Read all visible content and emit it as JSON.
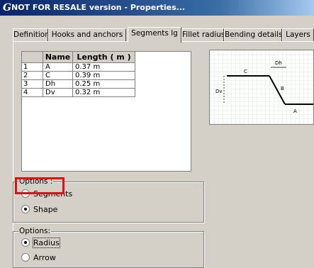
{
  "window": {
    "logo": "G",
    "title": "NOT FOR RESALE version - Properties..."
  },
  "tabs": [
    {
      "label": "Definition"
    },
    {
      "label": "Hooks and anchors"
    },
    {
      "label": "Segments lg"
    },
    {
      "label": "Fillet radius"
    },
    {
      "label": "Bending details"
    },
    {
      "label": "Layers"
    }
  ],
  "table": {
    "headers": {
      "name": "Name",
      "length": "Length ( m )"
    },
    "rows": [
      {
        "num": "1",
        "name": "A",
        "length": "0.37 m"
      },
      {
        "num": "2",
        "name": "C",
        "length": "0.39 m"
      },
      {
        "num": "3",
        "name": "Dh",
        "length": "0.25 m"
      },
      {
        "num": "4",
        "name": "Dv",
        "length": "0.32 m"
      }
    ]
  },
  "diagram": {
    "labels": {
      "c": "C",
      "dh": "Dh",
      "dv": "Dv",
      "b": "B",
      "a": "A"
    }
  },
  "options1": {
    "legend": "Options :",
    "items": [
      {
        "label": "Segments",
        "selected": false
      },
      {
        "label": "Shape",
        "selected": true
      }
    ]
  },
  "options2": {
    "legend": "Options:",
    "items": [
      {
        "label": "Radius",
        "selected": true
      },
      {
        "label": "Arrow",
        "selected": false
      }
    ]
  },
  "colors": {
    "highlight": "#e21010",
    "titlebar": "#0a246a"
  }
}
